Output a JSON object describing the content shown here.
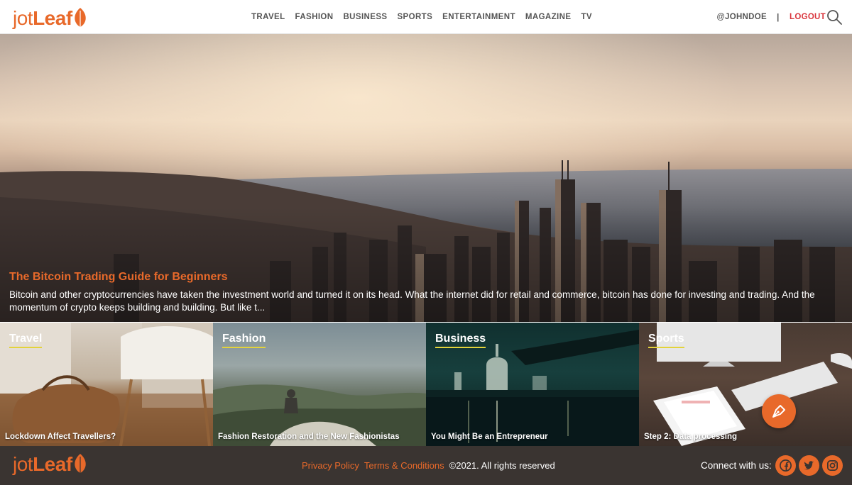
{
  "brand": {
    "name_part1": "jot",
    "name_part2": "Leaf",
    "accent_color": "#e8692a"
  },
  "nav": {
    "items": [
      {
        "label": "TRAVEL"
      },
      {
        "label": "FASHION"
      },
      {
        "label": "BUSINESS"
      },
      {
        "label": "SPORTS"
      },
      {
        "label": "ENTERTAINMENT"
      },
      {
        "label": "MAGAZINE"
      },
      {
        "label": "TV"
      }
    ]
  },
  "user": {
    "handle": "@JOHNDOE",
    "separator": "|",
    "logout_label": "LOGOUT",
    "search_icon": "search-icon"
  },
  "hero": {
    "title": "The Bitcoin Trading Guide for Beginners",
    "excerpt": "Bitcoin and other cryptocurrencies have taken the investment world and turned it on its head. What the internet did for retail and commerce, bitcoin has done for investing and trading. And the momentum of crypto keeps building and building. But like t..."
  },
  "tiles": [
    {
      "category": "Travel",
      "caption": "Lockdown Affect Travellers?"
    },
    {
      "category": "Fashion",
      "caption": "Fashion Restoration and the New Fashionistas"
    },
    {
      "category": "Business",
      "caption": "You Might Be an Entrepreneur"
    },
    {
      "category": "Sports",
      "caption": "Step 2: Data processing"
    }
  ],
  "fab": {
    "icon": "pen-nib-icon"
  },
  "footer": {
    "privacy_label": "Privacy Policy",
    "terms_label": "Terms & Conditions",
    "copyright": "©2021. All rights reserved",
    "connect_label": "Connect with us:",
    "social": [
      "facebook-icon",
      "twitter-icon",
      "instagram-icon"
    ]
  }
}
